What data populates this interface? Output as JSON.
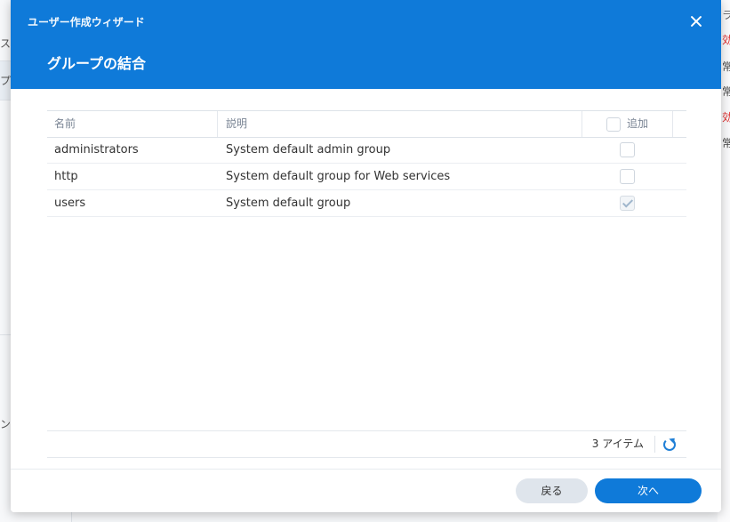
{
  "window": {
    "title": "ユーザー作成ウィザード",
    "step_title": "グループの結合"
  },
  "background": {
    "left_glyphs": [
      "ス",
      "プ",
      "ン"
    ],
    "right_glyphs": [
      {
        "text": "ラ",
        "color": "#666666"
      },
      {
        "text": "効",
        "color": "#e02b2b"
      },
      {
        "text": "常",
        "color": "#444444"
      },
      {
        "text": "常",
        "color": "#444444"
      },
      {
        "text": "効",
        "color": "#e02b2b"
      },
      {
        "text": "常",
        "color": "#444444"
      }
    ]
  },
  "grid": {
    "columns": {
      "name": "名前",
      "description": "説明",
      "add": "追加"
    },
    "rows": [
      {
        "name": "administrators",
        "description": "System default admin group",
        "added": false
      },
      {
        "name": "http",
        "description": "System default group for Web services",
        "added": false
      },
      {
        "name": "users",
        "description": "System default group",
        "added": true
      }
    ]
  },
  "paging": {
    "item_count": "3 アイテム",
    "refresh_icon": "refresh-icon"
  },
  "footer": {
    "back_label": "戻る",
    "next_label": "次へ"
  },
  "colors": {
    "accent": "#0f7ad9",
    "back_button_bg": "#dfe5ec",
    "alert_text": "#e02b2b"
  }
}
